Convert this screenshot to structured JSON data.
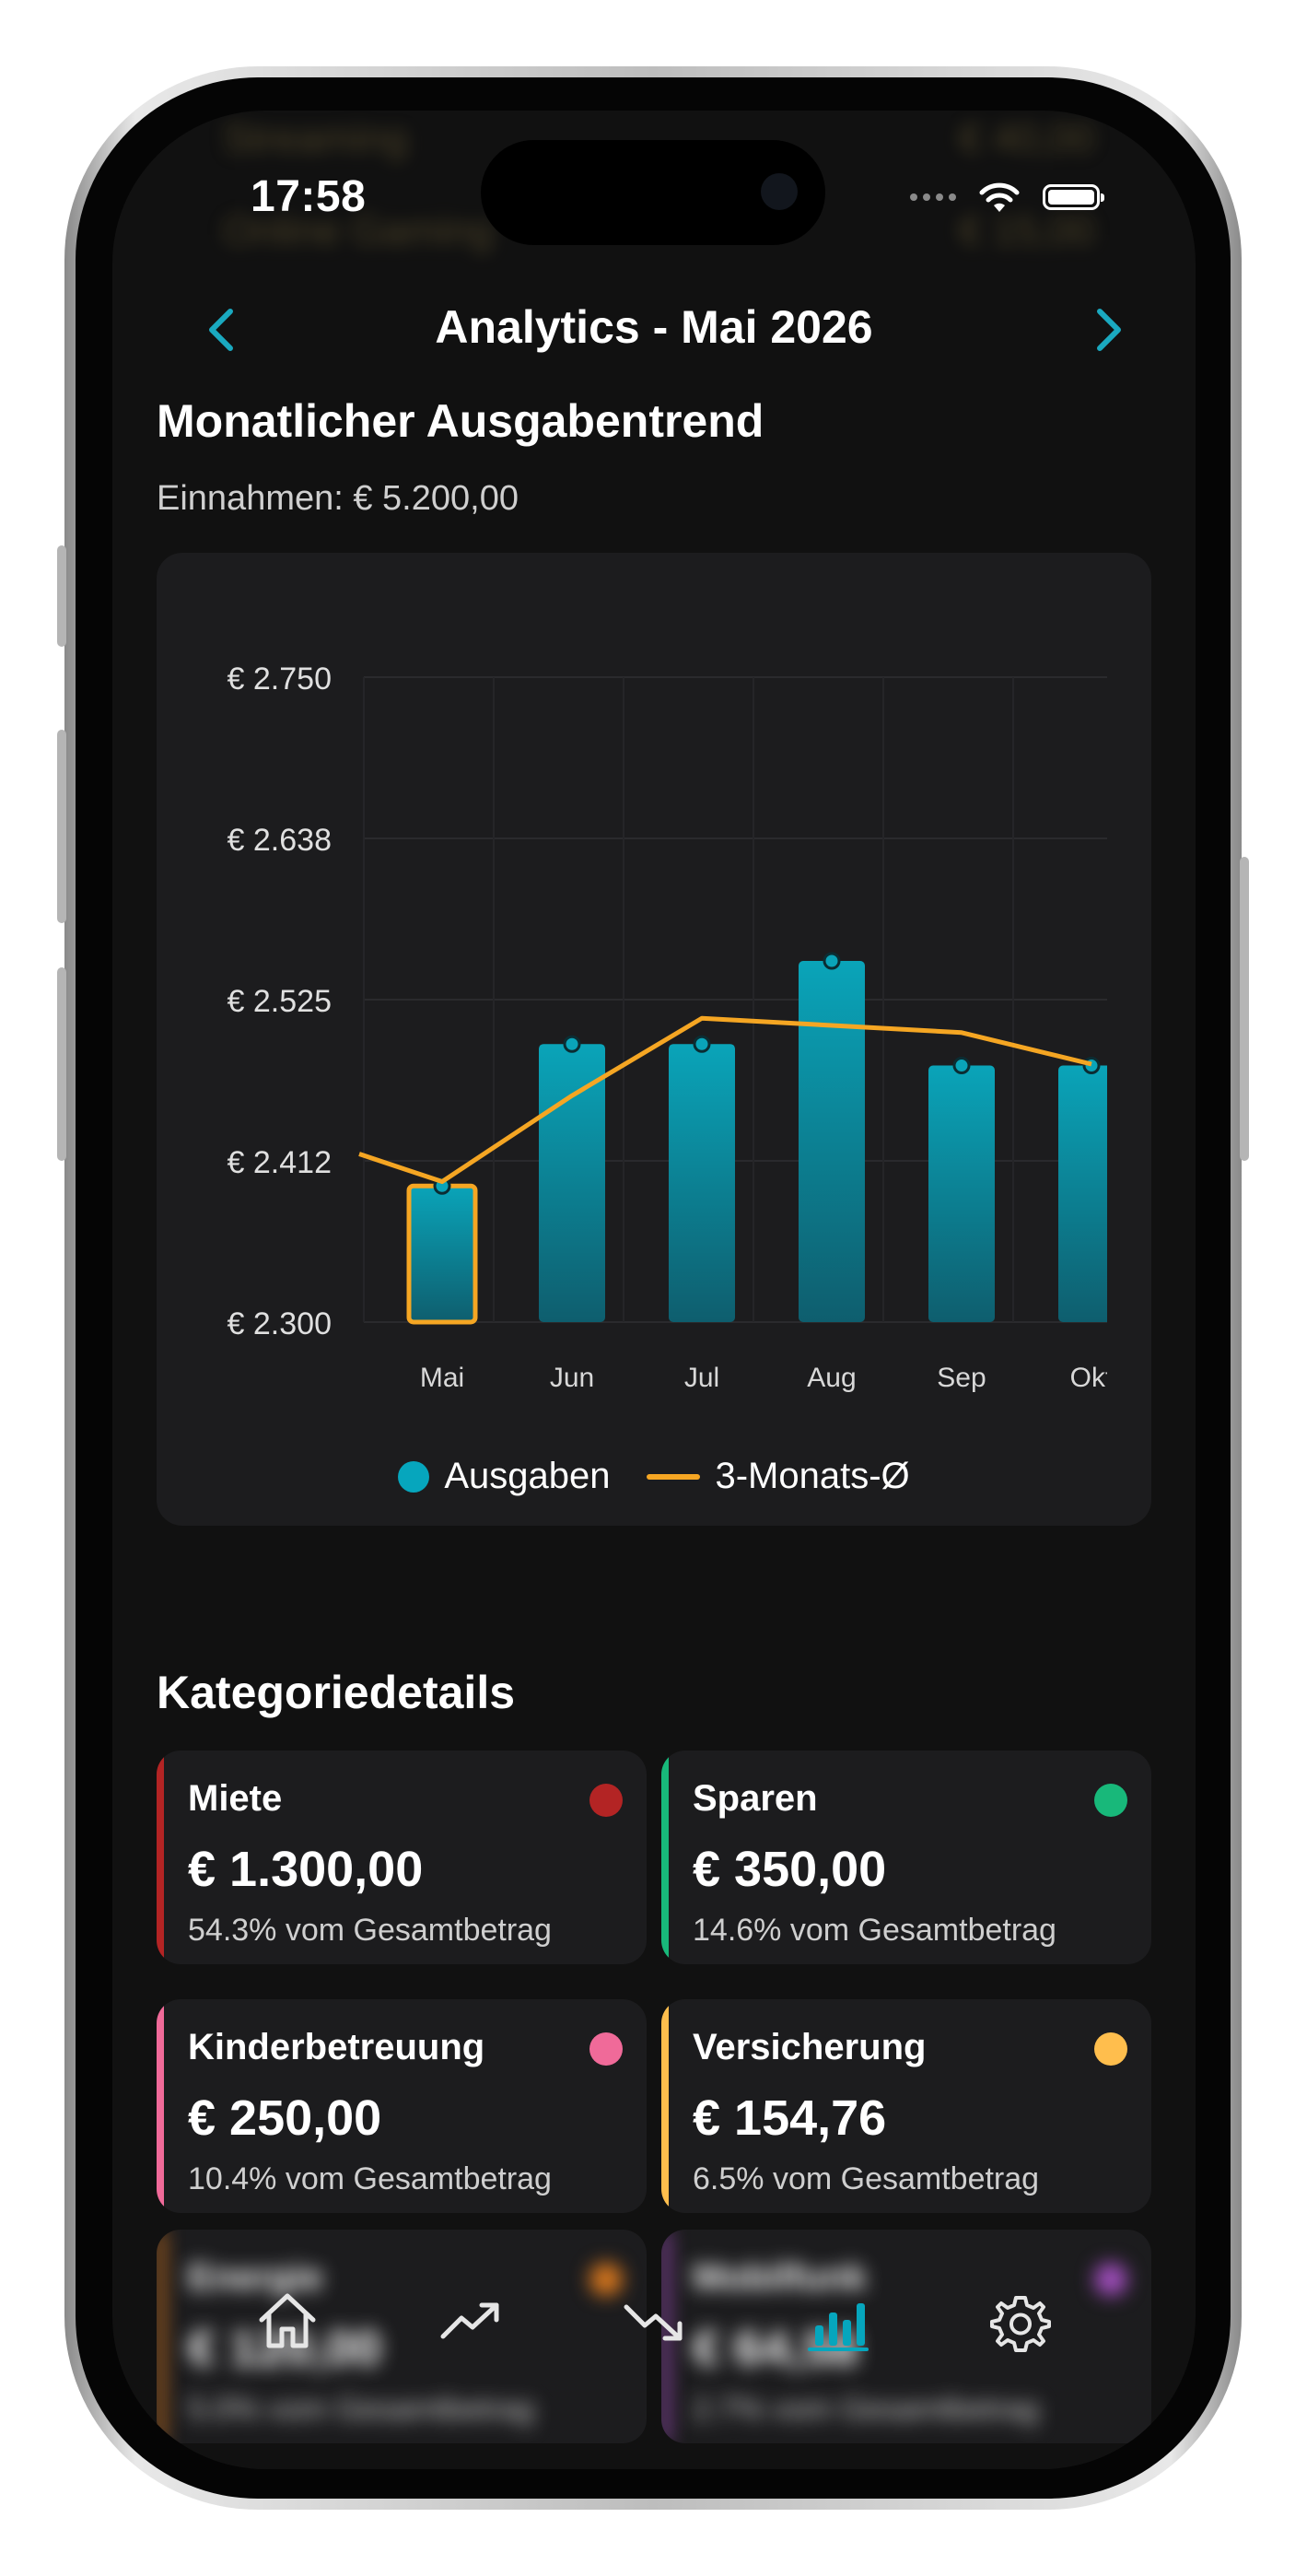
{
  "status_bar": {
    "time": "17:58"
  },
  "background_blur": {
    "row1_label": "Streaming",
    "row1_value": "€ 40,00",
    "row2_label": "Online Gaming",
    "row2_value": "€ 15,00"
  },
  "header": {
    "title": "Analytics - Mai 2026",
    "prev_icon": "chevron-left-icon",
    "next_icon": "chevron-right-icon"
  },
  "trend": {
    "title": "Monatlicher Ausgabentrend",
    "income": "Einnahmen: € 5.200,00"
  },
  "chart_data": {
    "type": "bar",
    "categories": [
      "Mai",
      "Jun",
      "Jul",
      "Aug",
      "Sep",
      "Okt"
    ],
    "y_tick_labels": [
      "€ 2.750",
      "€ 2.638",
      "€ 2.525",
      "€ 2.412",
      "€ 2.300"
    ],
    "ylim": [
      2300,
      2750
    ],
    "grid": true,
    "legend_position": "bottom",
    "selected_category": "Mai",
    "series": [
      {
        "name": "Ausgaben",
        "type": "bar",
        "color": "#06a6bd",
        "values": [
          2395,
          2494,
          2494,
          2552,
          2479,
          2479
        ]
      },
      {
        "name": "3-Monats-Ø",
        "type": "line",
        "color": "#f5a623",
        "values": [
          2398,
          2458,
          2512,
          2507,
          2502,
          2480
        ]
      }
    ]
  },
  "categories_section": {
    "title": "Kategoriedetails",
    "items": [
      {
        "name": "Miete",
        "amount": "€ 1.300,00",
        "percent": "54.3% vom Gesamtbetrag",
        "color": "#b32424"
      },
      {
        "name": "Sparen",
        "amount": "€ 350,00",
        "percent": "14.6% vom Gesamtbetrag",
        "color": "#18b87a"
      },
      {
        "name": "Kinderbetreuung",
        "amount": "€ 250,00",
        "percent": "10.4% vom Gesamtbetrag",
        "color": "#f06a99"
      },
      {
        "name": "Versicherung",
        "amount": "€ 154,76",
        "percent": "6.5% vom Gesamtbetrag",
        "color": "#ffbe4d"
      },
      {
        "name": "Energie",
        "amount": "€ 120,00",
        "percent": "5.0% vom Gesamtbetrag",
        "color": "#d9781e"
      },
      {
        "name": "Mobilfunk",
        "amount": "€ 64,58",
        "percent": "2.7% vom Gesamtbetrag",
        "color": "#a24fbf"
      }
    ]
  },
  "tabbar": {
    "tabs": [
      {
        "icon": "home-icon",
        "active": false
      },
      {
        "icon": "trending-up-icon",
        "active": false
      },
      {
        "icon": "trending-down-icon",
        "active": false
      },
      {
        "icon": "bar-chart-icon",
        "active": true
      },
      {
        "icon": "gear-icon",
        "active": false
      }
    ],
    "active_color": "#06a6bd"
  }
}
